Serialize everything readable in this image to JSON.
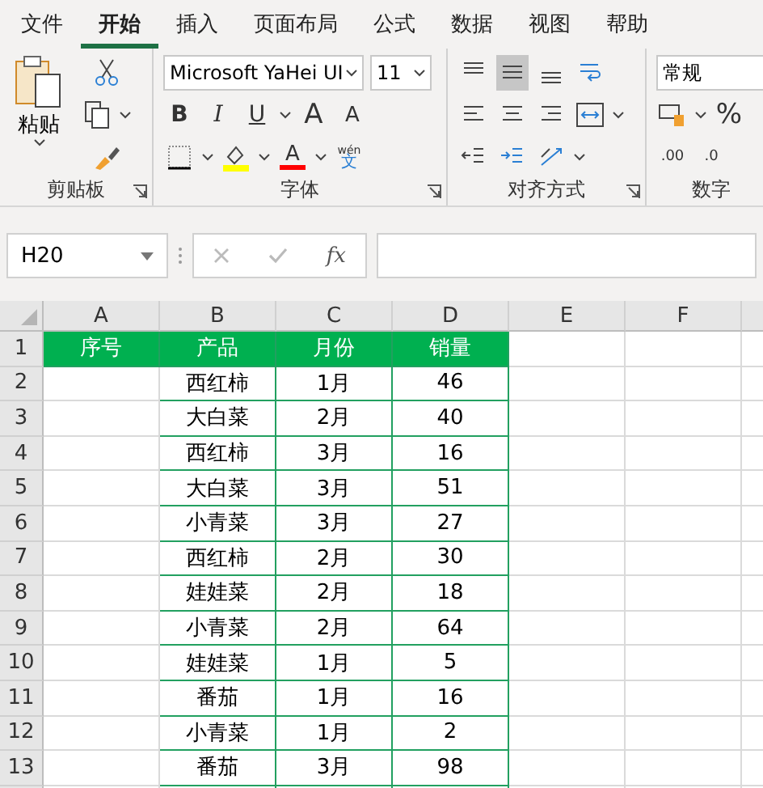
{
  "tabs": [
    {
      "label": "文件",
      "selected": false
    },
    {
      "label": "开始",
      "selected": true
    },
    {
      "label": "插入",
      "selected": false
    },
    {
      "label": "页面布局",
      "selected": false
    },
    {
      "label": "公式",
      "selected": false
    },
    {
      "label": "数据",
      "selected": false
    },
    {
      "label": "视图",
      "selected": false
    },
    {
      "label": "帮助",
      "selected": false
    }
  ],
  "ribbon": {
    "clipboard": {
      "paste_label": "粘贴",
      "group_label": "剪贴板"
    },
    "font": {
      "name": "Microsoft YaHei UI",
      "size": "11",
      "bold": "B",
      "italic": "I",
      "underline": "U",
      "grow": "A",
      "shrink": "A",
      "font_color": "A",
      "phonetic": "wén",
      "phonetic_char": "文",
      "group_label": "字体"
    },
    "alignment": {
      "vertical": [
        {
          "kind": "top",
          "selected": false
        },
        {
          "kind": "middle",
          "selected": true
        },
        {
          "kind": "bottom",
          "selected": false
        }
      ],
      "group_label": "对齐方式"
    },
    "number": {
      "format": "常规",
      "percent": "%",
      "increase_decimal": ".00",
      "decrease_decimal": ".0",
      "group_label": "数字"
    }
  },
  "formula_bar": {
    "name_box": "H20",
    "fx": "fx"
  },
  "sheet": {
    "columns": [
      "A",
      "B",
      "C",
      "D",
      "E",
      "F"
    ],
    "header": [
      "序号",
      "产品",
      "月份",
      "销量"
    ],
    "rows": [
      {
        "number": "2",
        "cells": [
          "",
          "西红柿",
          "1月",
          "46"
        ]
      },
      {
        "number": "3",
        "cells": [
          "",
          "大白菜",
          "2月",
          "40"
        ]
      },
      {
        "number": "4",
        "cells": [
          "",
          "西红柿",
          "3月",
          "16"
        ]
      },
      {
        "number": "5",
        "cells": [
          "",
          "大白菜",
          "3月",
          "51"
        ]
      },
      {
        "number": "6",
        "cells": [
          "",
          "小青菜",
          "3月",
          "27"
        ]
      },
      {
        "number": "7",
        "cells": [
          "",
          "西红柿",
          "2月",
          "30"
        ]
      },
      {
        "number": "8",
        "cells": [
          "",
          "娃娃菜",
          "2月",
          "18"
        ]
      },
      {
        "number": "9",
        "cells": [
          "",
          "小青菜",
          "2月",
          "64"
        ]
      },
      {
        "number": "10",
        "cells": [
          "",
          "娃娃菜",
          "1月",
          "5"
        ]
      },
      {
        "number": "11",
        "cells": [
          "",
          "番茄",
          "1月",
          "16"
        ]
      },
      {
        "number": "12",
        "cells": [
          "",
          "小青菜",
          "1月",
          "2"
        ]
      },
      {
        "number": "13",
        "cells": [
          "",
          "番茄",
          "3月",
          "98"
        ]
      }
    ],
    "header_row_number": "1"
  }
}
